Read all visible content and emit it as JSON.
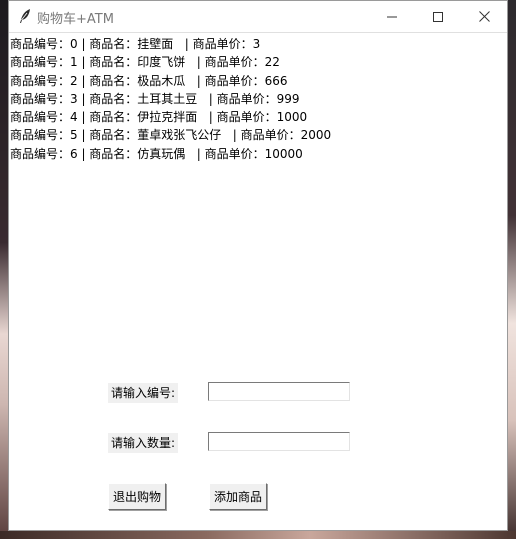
{
  "window": {
    "title": "购物车+ATM"
  },
  "products": [
    {
      "row": "商品编号：0 | 商品名：挂壁面   | 商品单价：3"
    },
    {
      "row": "商品编号：1 | 商品名：印度飞饼   | 商品单价：22"
    },
    {
      "row": "商品编号：2 | 商品名：极品木瓜   | 商品单价：666"
    },
    {
      "row": "商品编号：3 | 商品名：土耳其土豆   | 商品单价：999"
    },
    {
      "row": "商品编号：4 | 商品名：伊拉克拌面   | 商品单价：1000"
    },
    {
      "row": "商品编号：5 | 商品名：董卓戏张飞公仔   | 商品单价：2000"
    },
    {
      "row": "商品编号：6 | 商品名：仿真玩偶   | 商品单价：10000"
    }
  ],
  "form": {
    "id_label": "请输入编号:",
    "id_value": "",
    "qty_label": "请输入数量:",
    "qty_value": ""
  },
  "buttons": {
    "exit": "退出购物",
    "add": "添加商品"
  },
  "icons": {
    "app": "feather-icon",
    "minimize": "minimize-icon",
    "maximize": "maximize-icon",
    "close": "close-icon"
  }
}
